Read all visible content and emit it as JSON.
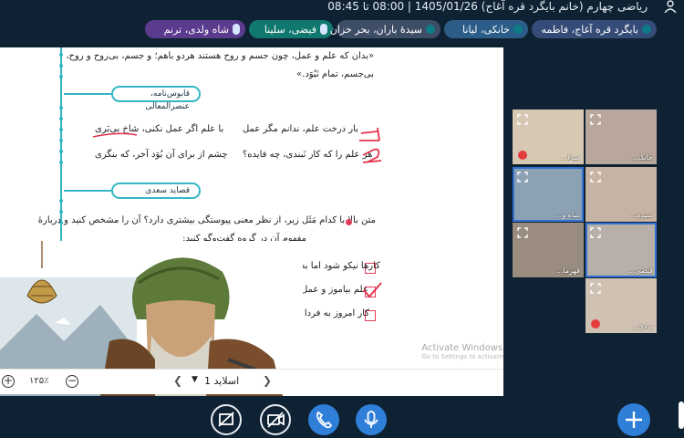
{
  "window": {
    "title": "ریاضی چهارم (خانم بایگرد قره آغاج) 1405/01/26 | 08:00 تا 08:45",
    "user_icon": "user-icon"
  },
  "participants": [
    {
      "label": "بایگرد قره آغاج، فاطمه",
      "color": "#364c78"
    },
    {
      "label": "خانکی، لیانا",
      "color": "#2c5d89"
    },
    {
      "label": "سیدۀ باران، بحر خزان",
      "color": "#3e4d66"
    },
    {
      "label": "فیضی، سلینا",
      "color": "#11786f",
      "icon": "mic-icon"
    },
    {
      "label": "شاه ولدی، ترنم",
      "color": "#5b3b8e",
      "icon": "mic-icon"
    }
  ],
  "slide": {
    "quote_line1": "«بدان که علم و عمل، چون جسم و روح هستند هردو باهم؛ و جسم، بی‌روح و روح،",
    "quote_line2": "بی‌جسم، تمام نَبُوَد.»",
    "tag1": "قابوس‌نامه، عنصرالمعالی",
    "verse1_right": "بار درخت علم، ندانم مگر عمل",
    "verse1_left": "با علم اگر عمل نکنی، شاخ بی‌بَری",
    "verse2_right": "هر علم را که کار نَبندی، چه فایده؟",
    "verse2_left": "چشم از برای آن بُوَد آخر، که بنگری",
    "annot1": "١",
    "annot2": "٢",
    "tag2": "قصاید سعدی",
    "question_line1": "متن بالا با کدام مَثَل زیر، از نظر معنی پیوستگی بیشتری دارد؟ آن را مشخص کنید و دربارۀ",
    "question_line2": "مفهوم آن در گروه گفت‌وگو کنید:",
    "options": [
      "کارها نیکو شود اما به صبر.",
      "علم بیاموز و عمل پیشه کن.",
      "کار امروز به فردا مفکن."
    ],
    "selected_option": 1,
    "watermark_title": "Activate Windows",
    "watermark_sub": "Go to Settings to activate"
  },
  "slide_toolbar": {
    "zoom_value": "۱۲۵٪",
    "slide_label": "اسلاید 1"
  },
  "video_tiles": [
    {
      "name": "خانک...",
      "active": false
    },
    {
      "name": "سرا...",
      "active": false,
      "muted": true
    },
    {
      "name": "سیده...",
      "active": false
    },
    {
      "name": "شاه و...",
      "active": true
    },
    {
      "name": "فیضی...",
      "active": true
    },
    {
      "name": "قهرما...",
      "active": false
    },
    {
      "name": "بردی...",
      "active": false,
      "muted": true
    }
  ],
  "controls": [
    "share-screen-button",
    "camera-off-button",
    "phone-button",
    "mic-button",
    "add-button"
  ]
}
